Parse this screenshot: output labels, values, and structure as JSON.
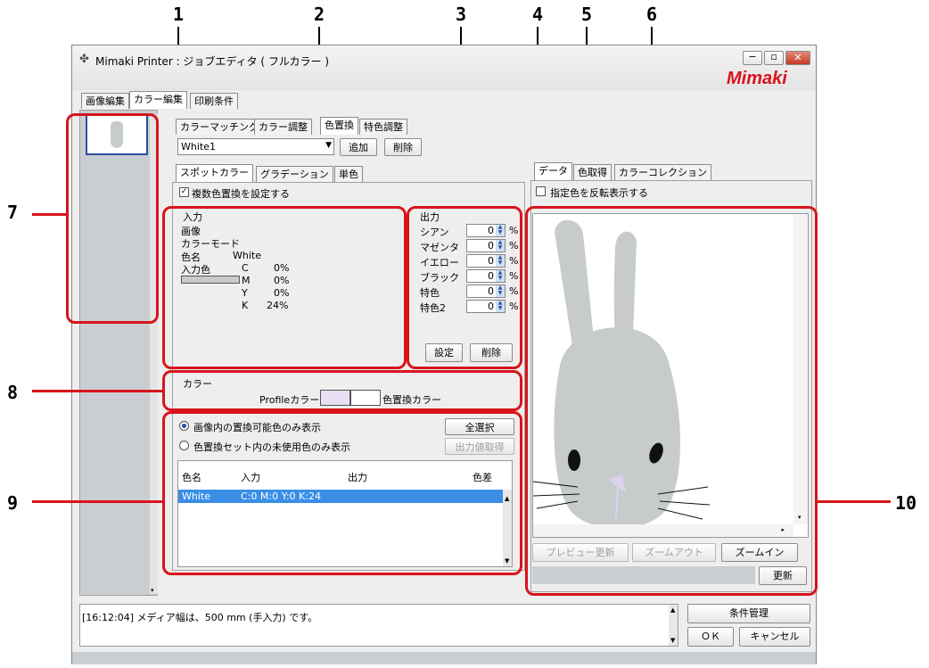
{
  "callouts": [
    "1",
    "2",
    "3",
    "4",
    "5",
    "6",
    "7",
    "8",
    "9",
    "10"
  ],
  "window": {
    "title": "Mimaki Printer : ジョブエディタ ( フルカラー )",
    "brand_logo": "Mimaki",
    "title_controls": [
      "minimize-icon",
      "maximize-icon",
      "close-icon"
    ]
  },
  "top_tabs": [
    "画像編集",
    "カラー編集",
    "印刷条件"
  ],
  "sub_tabs": [
    "カラーマッチング",
    "カラー調整",
    "色置換",
    "特色調整"
  ],
  "set_select": {
    "value": "White1"
  },
  "set_buttons": {
    "add": "追加",
    "delete": "削除"
  },
  "replace_tabs": [
    "スポットカラー",
    "グラデーション",
    "単色"
  ],
  "multi_checkbox": {
    "label": "複数色置換を設定する",
    "checked": true
  },
  "input_group": {
    "title": "入力",
    "image_label": "画像",
    "color_mode_label": "カラーモード",
    "color_name_label": "色名",
    "color_name_value": "White",
    "input_color_label": "入力色",
    "cmyk": [
      {
        "ch": "C",
        "val": "0%"
      },
      {
        "ch": "M",
        "val": "0%"
      },
      {
        "ch": "Y",
        "val": "0%"
      },
      {
        "ch": "K",
        "val": "24%"
      }
    ]
  },
  "output_group": {
    "title": "出力",
    "rows": [
      {
        "label": "シアン",
        "value": "0",
        "unit": "%"
      },
      {
        "label": "マゼンタ",
        "value": "0",
        "unit": "%"
      },
      {
        "label": "イエロー",
        "value": "0",
        "unit": "%"
      },
      {
        "label": "ブラック",
        "value": "0",
        "unit": "%"
      },
      {
        "label": "特色",
        "value": "0",
        "unit": "%"
      },
      {
        "label": "特色2",
        "value": "0",
        "unit": "%"
      }
    ],
    "set_button": "設定",
    "delete_button": "削除"
  },
  "color_group": {
    "title": "カラー",
    "profile_label": "Profileカラー",
    "replace_label": "色置換カラー"
  },
  "list_options": {
    "radio1": "画像内の置換可能色のみ表示",
    "radio2": "色置換セット内の未使用色のみ表示",
    "select_all": "全選択",
    "get_output": "出力値取得"
  },
  "table": {
    "headers": [
      "色名",
      "入力",
      "出力",
      "色差"
    ],
    "rows": [
      {
        "name": "White",
        "input": "C:0 M:0 Y:0 K:24",
        "output": "",
        "diff": ""
      }
    ]
  },
  "right_tabs": [
    "データ",
    "色取得",
    "カラーコレクション"
  ],
  "invert_checkbox": {
    "label": "指定色を反転表示する",
    "checked": false
  },
  "preview_buttons": {
    "refresh": "プレビュー更新",
    "zoom_out": "ズームアウト",
    "zoom_in": "ズームイン"
  },
  "update_button": "更新",
  "log": {
    "text": "[16:12:04] メディア幅は、500 mm (手入力) です。"
  },
  "bottom_buttons": {
    "manage": "条件管理",
    "ok": "ＯＫ",
    "cancel": "キャンセル"
  },
  "colors": {
    "callout_red": "#d8141c",
    "selection_blue": "#3a8ee6",
    "rabbit_gray": "#c7cccb",
    "nose_lavender": "#dcd2f0"
  }
}
